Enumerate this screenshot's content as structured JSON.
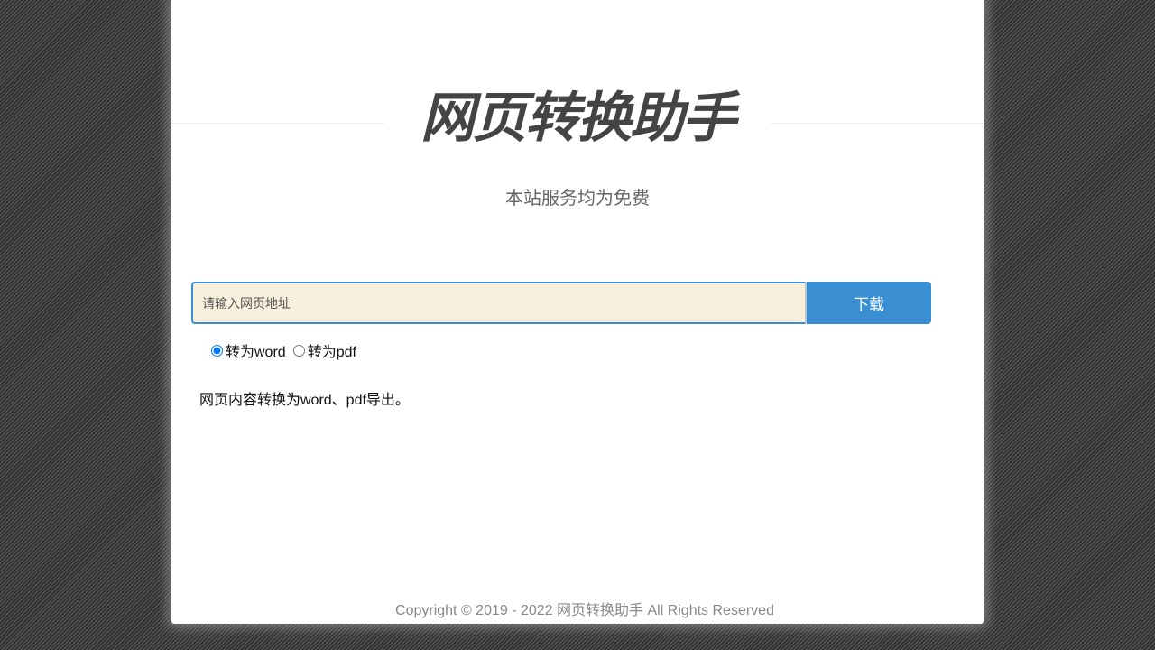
{
  "header": {
    "title": "网页转换助手",
    "subtitle": "本站服务均为免费"
  },
  "form": {
    "url_placeholder": "请输入网页地址",
    "url_value": "",
    "download_label": "下载",
    "format_options": [
      {
        "label": "转为word",
        "selected": true
      },
      {
        "label": "转为pdf",
        "selected": false
      }
    ]
  },
  "main": {
    "description": "网页内容转换为word、pdf导出。"
  },
  "footer": {
    "copyright": "Copyright © 2019 - 2022 网页转换助手  All Rights Reserved"
  },
  "colors": {
    "accent": "#3a8fd3",
    "input_background": "#f8efdc",
    "title": "#444444"
  }
}
